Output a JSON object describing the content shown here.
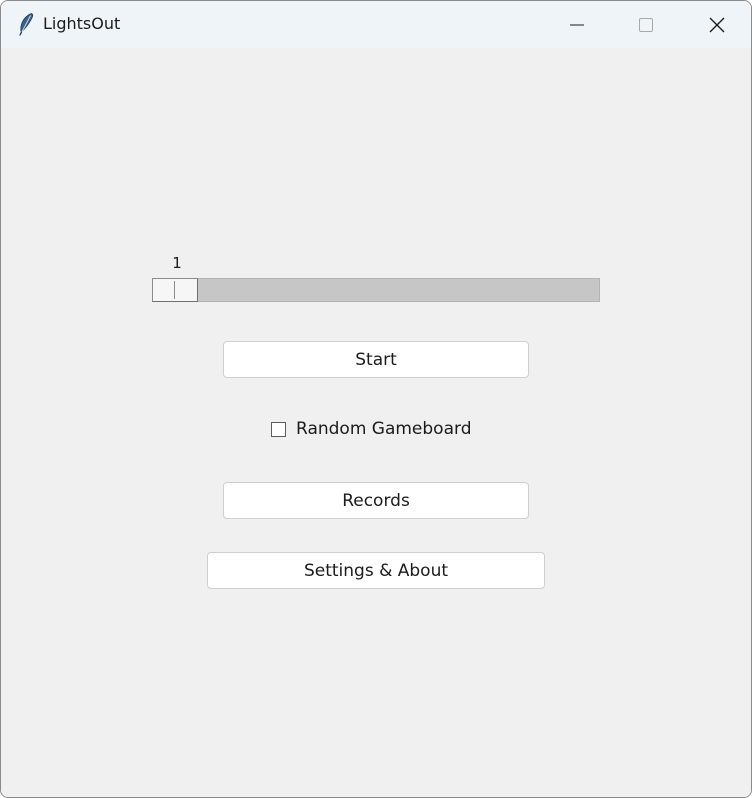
{
  "window": {
    "title": "LightsOut",
    "icon": "feather-icon",
    "controls": {
      "minimize_icon": "minimize-icon",
      "maximize_icon": "maximize-icon",
      "close_icon": "close-icon"
    }
  },
  "scale": {
    "value": "1",
    "position_fraction": 0
  },
  "buttons": {
    "start_label": "Start",
    "records_label": "Records",
    "settings_label": "Settings & About"
  },
  "random_gameboard": {
    "label": "Random Gameboard",
    "checked": false
  },
  "colors": {
    "background": "#f0f0f0",
    "titlebar": "#eff4f9",
    "trough": "#c6c6c6"
  }
}
